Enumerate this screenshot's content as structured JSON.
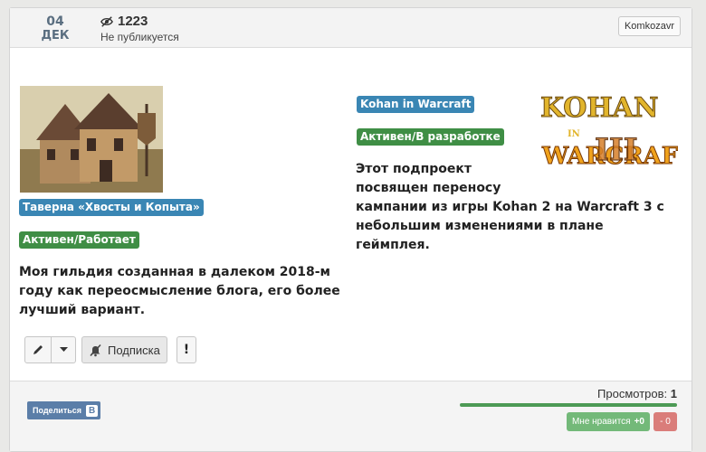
{
  "header": {
    "date_day": "04",
    "date_month": "ДЕК",
    "view_count": "1223",
    "status": "Не публикуется",
    "author": "Komkozavr"
  },
  "left_project": {
    "title_badge": "Таверна «Хвосты и Копыта»",
    "status_badge": "Активен/Работает",
    "description_lines": [
      "Моя гильдия созданная в далеком 2018-м",
      "году как переосмысление блога, его более",
      "лучший вариант."
    ]
  },
  "right_project": {
    "title_badge": "Kohan in Warcraft",
    "status_badge": "Активен/В разработке",
    "logo_text": [
      "KOHAN",
      "IN",
      "WARCRAFT",
      "III"
    ],
    "description_lines": [
      "Этот подпроект",
      "посвящен переносу",
      "кампании из игры Kohan 2 на Warcraft 3 с",
      "небольшим изменениями в плане",
      "геймплея."
    ]
  },
  "toolbar": {
    "subscribe_label": "Подписка",
    "report_label": "!"
  },
  "footer": {
    "share_label": "Поделиться",
    "vk_label": "В",
    "views_label": "Просмотров:",
    "views_value": "1",
    "like_label": "Мне нравится",
    "like_count": "+0",
    "dislike_count": "- 0"
  },
  "colors": {
    "blue_badge": "#3a86b4",
    "green_badge": "#3f8e45",
    "like": "#73b979",
    "dislike": "#da7d7a",
    "share": "#5b7ea8"
  }
}
